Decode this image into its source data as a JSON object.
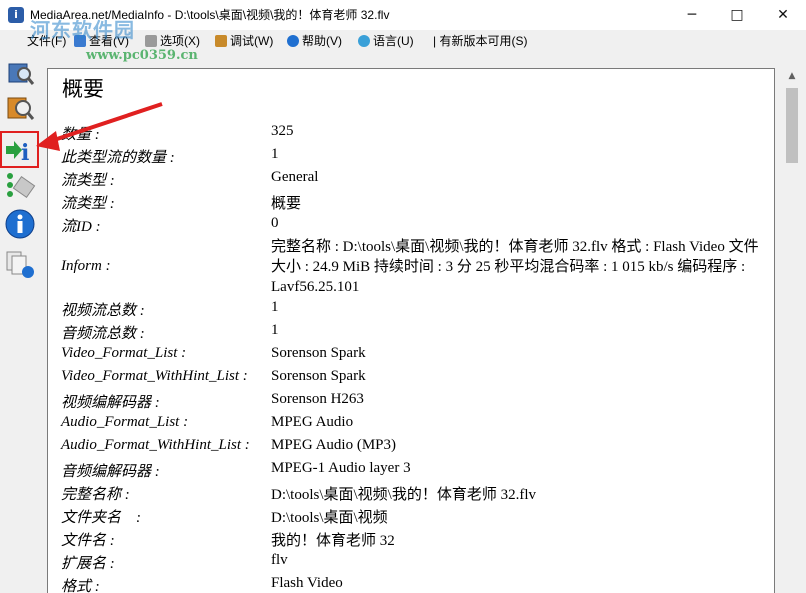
{
  "window": {
    "title": "MediaArea.net/MediaInfo - D:\\tools\\桌面\\视频\\我的！体育老师 32.flv",
    "minimize": "─",
    "maximize": "□",
    "close": "✕"
  },
  "watermark": {
    "text": "河东软件园",
    "url": "www.pc0359.cn"
  },
  "menu": {
    "file": "文件(F)",
    "view": "查看(V)",
    "options": "选项(X)",
    "debug": "调试(W)",
    "help": "帮助(V)",
    "language": "语言(U)",
    "update": "| 有新版本可用(S)"
  },
  "sidebar": {
    "items": [
      {
        "icon": "easy-view-icon"
      },
      {
        "icon": "sheet-view-icon"
      },
      {
        "icon": "info-view-icon",
        "selected": true
      },
      {
        "icon": "tree-view-icon"
      },
      {
        "icon": "about-icon"
      },
      {
        "icon": "export-icon"
      }
    ]
  },
  "content": {
    "section": "概要",
    "rows": [
      {
        "key": "数量 :",
        "value": "325"
      },
      {
        "key": "此类型流的数量 :",
        "value": "1"
      },
      {
        "key": "流类型 :",
        "value": "General"
      },
      {
        "key": "流类型 :",
        "value": "概要"
      },
      {
        "key": "流ID :",
        "value": "0"
      },
      {
        "key": "Inform :",
        "value": "完整名称 : D:\\tools\\桌面\\视频\\我的！体育老师 32.flv 格式 : Flash Video 文件大小 : 24.9 MiB 持续时间 : 3 分 25 秒平均混合码率 : 1 015 kb/s 编码程序 : Lavf56.25.101"
      },
      {
        "key": "视频流总数 :",
        "value": "1"
      },
      {
        "key": "音频流总数 :",
        "value": "1"
      },
      {
        "key": "Video_Format_List :",
        "value": "Sorenson Spark"
      },
      {
        "key": "Video_Format_WithHint_List :",
        "value": "Sorenson Spark"
      },
      {
        "key": "视频编解码器 :",
        "value": "Sorenson H263"
      },
      {
        "key": "Audio_Format_List :",
        "value": "MPEG Audio"
      },
      {
        "key": "Audio_Format_WithHint_List :",
        "value": "MPEG Audio (MP3)"
      },
      {
        "key": "音频编解码器 :",
        "value": "MPEG-1 Audio layer 3"
      },
      {
        "key": "完整名称 :",
        "value": "D:\\tools\\桌面\\视频\\我的！体育老师 32.flv"
      },
      {
        "key": "文件夹名　:",
        "value": "D:\\tools\\桌面\\视频"
      },
      {
        "key": "文件名 :",
        "value": "我的！体育老师 32"
      },
      {
        "key": "扩展名 :",
        "value": "flv"
      },
      {
        "key": "格式 :",
        "value": "Flash Video"
      }
    ]
  },
  "colors": {
    "highlight_red": "#e02020",
    "content_bg": "#ffffff",
    "chrome_bg": "#f0f0f0"
  }
}
